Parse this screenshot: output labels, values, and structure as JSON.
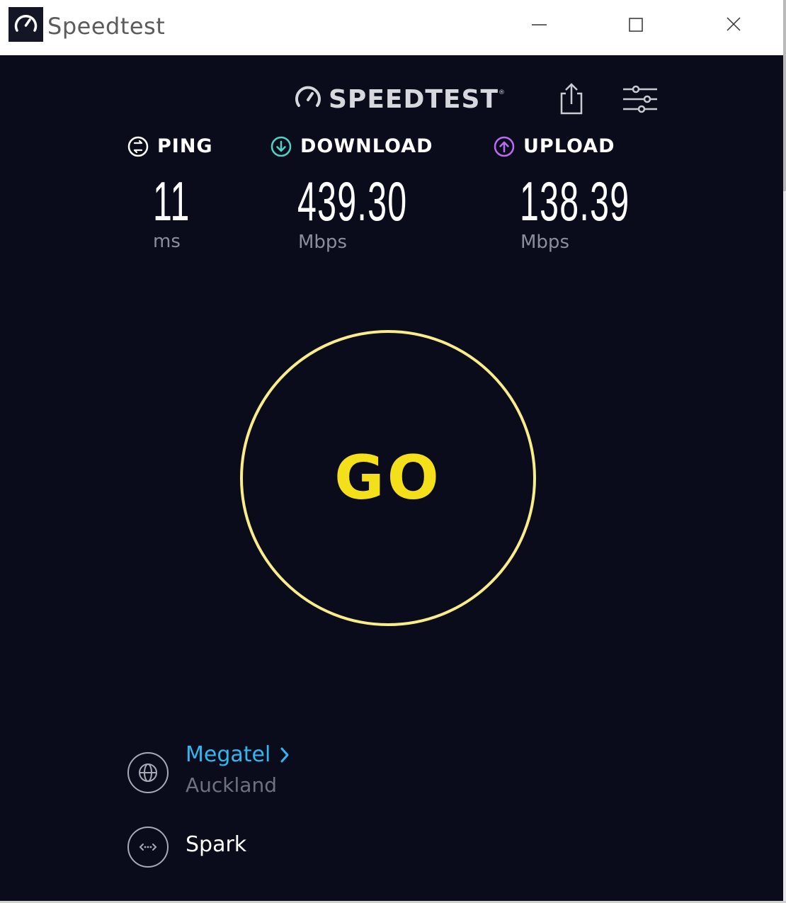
{
  "window": {
    "title": "Speedtest",
    "controls": {
      "minimize": "minimize",
      "maximize": "maximize",
      "close": "close"
    }
  },
  "header": {
    "logo_text": "SPEEDTEST",
    "logo_tm": "®",
    "share_icon": "share-icon",
    "settings_icon": "settings-sliders-icon"
  },
  "metrics": {
    "ping": {
      "label": "PING",
      "value": "11",
      "unit": "ms",
      "icon": "ping-icon",
      "color": "#ffffff"
    },
    "download": {
      "label": "DOWNLOAD",
      "value": "439.30",
      "unit": "Mbps",
      "icon": "download-arrow-icon",
      "color": "#4fd1c5"
    },
    "upload": {
      "label": "UPLOAD",
      "value": "138.39",
      "unit": "Mbps",
      "icon": "upload-arrow-icon",
      "color": "#b86cf0"
    }
  },
  "go_button": {
    "label": "GO",
    "ring_color": "#f8ec8b",
    "text_color": "#f4e01a"
  },
  "server": {
    "name": "Megatel",
    "location": "Auckland",
    "icon": "globe-icon",
    "name_color": "#2fb7f2"
  },
  "isp": {
    "name": "Spark",
    "icon": "connection-icon"
  },
  "colors": {
    "background": "#0b0c1b"
  }
}
